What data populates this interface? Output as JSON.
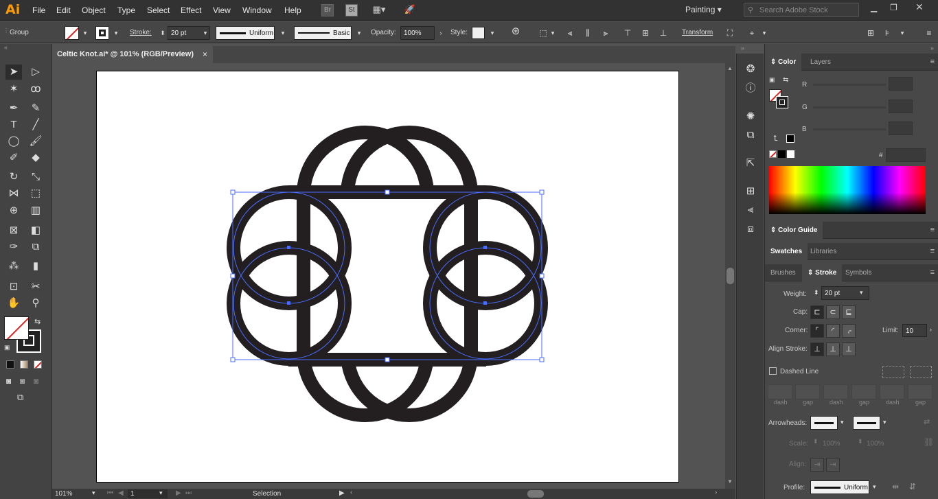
{
  "app": {
    "logo": "Ai",
    "menus": [
      "File",
      "Edit",
      "Object",
      "Type",
      "Select",
      "Effect",
      "View",
      "Window",
      "Help"
    ],
    "bridge": "Br",
    "stock": "St",
    "workspace": "Painting",
    "search_placeholder": "Search Adobe Stock"
  },
  "control": {
    "selection_type": "Group",
    "stroke_label": "Stroke:",
    "stroke_weight": "20 pt",
    "profile_uniform": "Uniform",
    "brush_basic": "Basic",
    "opacity_label": "Opacity:",
    "opacity_value": "100%",
    "style_label": "Style:",
    "transform_label": "Transform"
  },
  "document": {
    "tab_title": "Celtic Knot.ai* @ 101% (RGB/Preview)",
    "close": "×"
  },
  "status": {
    "zoom": "101%",
    "artboard_num": "1",
    "tool": "Selection"
  },
  "color_panel": {
    "tab_color": "Color",
    "tab_layers": "Layers",
    "r": "R",
    "g": "G",
    "b": "B",
    "hash": "#"
  },
  "color_guide": {
    "title": "Color Guide"
  },
  "swatches": {
    "tab_swatches": "Swatches",
    "tab_libraries": "Libraries"
  },
  "stroke_panel": {
    "tab_brushes": "Brushes",
    "tab_stroke": "Stroke",
    "tab_symbols": "Symbols",
    "weight_label": "Weight:",
    "weight_value": "20 pt",
    "cap_label": "Cap:",
    "corner_label": "Corner:",
    "limit_label": "Limit:",
    "limit_value": "10",
    "align_label": "Align Stroke:",
    "dashed_label": "Dashed Line",
    "dash": "dash",
    "gap": "gap",
    "arrowheads_label": "Arrowheads:",
    "scale_label": "Scale:",
    "scale1": "100%",
    "scale2": "100%",
    "align2_label": "Align:",
    "profile_label": "Profile:",
    "profile_value": "Uniform"
  },
  "colors": {
    "accent": "#ff9a00",
    "knot": "#231f20",
    "selection": "#4a6cff"
  }
}
